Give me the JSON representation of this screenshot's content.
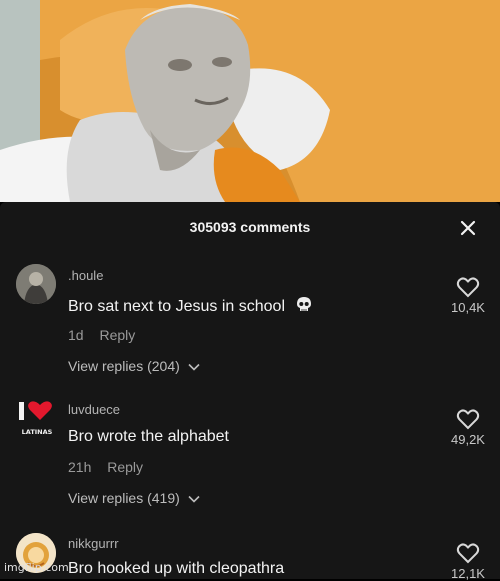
{
  "header": {
    "comment_count": "305093 comments"
  },
  "comments": [
    {
      "username": ".houle",
      "text": "Bro sat next to Jesus in school",
      "emoji": "skull-emoji",
      "time": "1d",
      "reply_label": "Reply",
      "view_replies": "View replies (204)",
      "likes": "10,4K"
    },
    {
      "username": "luvduece",
      "text": "Bro wrote the alphabet",
      "time": "21h",
      "reply_label": "Reply",
      "view_replies": "View replies (419)",
      "likes": "49,2K",
      "avatar_text": "LATINAS"
    },
    {
      "username": "nikkgurrr",
      "text": "Bro hooked up with cleopathra",
      "likes": "12,1K"
    }
  ],
  "watermark": "imgflip.com",
  "colors": {
    "panel": "#161616",
    "photo_bg": "#e9a23a"
  }
}
